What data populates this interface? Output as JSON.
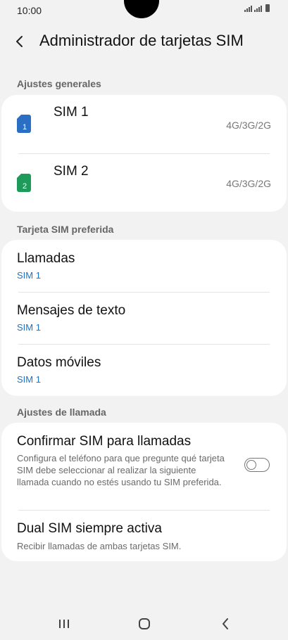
{
  "status_bar": {
    "time": "10:00",
    "icons": [
      "signal-icon",
      "signal-icon",
      "battery-icon"
    ]
  },
  "header": {
    "title": "Administrador de tarjetas SIM",
    "back_icon": "back-arrow-icon"
  },
  "sections": {
    "general": "Ajustes generales",
    "preferred": "Tarjeta SIM preferida",
    "call": "Ajustes de llamada"
  },
  "sims": [
    {
      "name": "SIM 1",
      "tech": "4G/3G/2G",
      "number": "1",
      "color": "#2a6fc4"
    },
    {
      "name": "SIM 2",
      "tech": "4G/3G/2G",
      "number": "2",
      "color": "#1e9a5a"
    }
  ],
  "preferred": [
    {
      "title": "Llamadas",
      "value": "SIM 1"
    },
    {
      "title": "Mensajes de texto",
      "value": "SIM 1"
    },
    {
      "title": "Datos móviles",
      "value": "SIM 1"
    }
  ],
  "call_settings": {
    "confirm": {
      "title": "Confirmar SIM para llamadas",
      "desc": "Configura el teléfono para que pregunte qué tarjeta SIM debe seleccionar al realizar la siguiente llamada cuando no estés usando tu SIM preferida.",
      "enabled": false
    },
    "dual": {
      "title": "Dual SIM siempre activa",
      "desc": "Recibir llamadas de ambas tarjetas SIM."
    }
  },
  "nav_bar": {
    "icons": [
      "recent-apps-icon",
      "home-icon",
      "back-icon"
    ]
  },
  "colors": {
    "accent": "#1a73c8",
    "background": "#f2f2f2",
    "card": "#ffffff"
  }
}
